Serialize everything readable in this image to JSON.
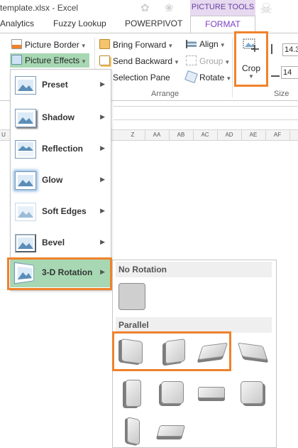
{
  "window": {
    "title": "template.xlsx - Excel",
    "contextual_group": "PICTURE TOOLS"
  },
  "tabs": [
    "Analytics",
    "Fuzzy Lookup",
    "POWERPIVOT",
    "FORMAT"
  ],
  "ribbon": {
    "picture_border": "Picture Border",
    "picture_effects": "Picture Effects",
    "bring_forward": "Bring Forward",
    "send_backward": "Send Backward",
    "selection_pane": "Selection Pane",
    "align": "Align",
    "group": "Group",
    "rotate": "Rotate",
    "crop": "Crop",
    "arrange_label": "Arrange",
    "size_label": "Size",
    "height_value": "14.3",
    "width_value": "14"
  },
  "columns": [
    "U",
    "Z",
    "AA",
    "AB",
    "AC",
    "AD",
    "AE",
    "AF"
  ],
  "effects_menu": [
    {
      "label": "Preset",
      "icon": "preset-icon"
    },
    {
      "label": "Shadow",
      "icon": "shadow-icon"
    },
    {
      "label": "Reflection",
      "icon": "reflection-icon"
    },
    {
      "label": "Glow",
      "icon": "glow-icon"
    },
    {
      "label": "Soft Edges",
      "icon": "soft-edges-icon"
    },
    {
      "label": "Bevel",
      "icon": "bevel-icon"
    },
    {
      "label": "3-D Rotation",
      "icon": "3d-rotation-icon"
    }
  ],
  "gallery": {
    "no_rotation_header": "No Rotation",
    "parallel_header": "Parallel"
  },
  "colors": {
    "accent_highlight": "#f0822c",
    "active_item": "#a7d8b3",
    "picture_tools": "#e6d9f0",
    "format_tab": "#7b3fbf"
  }
}
